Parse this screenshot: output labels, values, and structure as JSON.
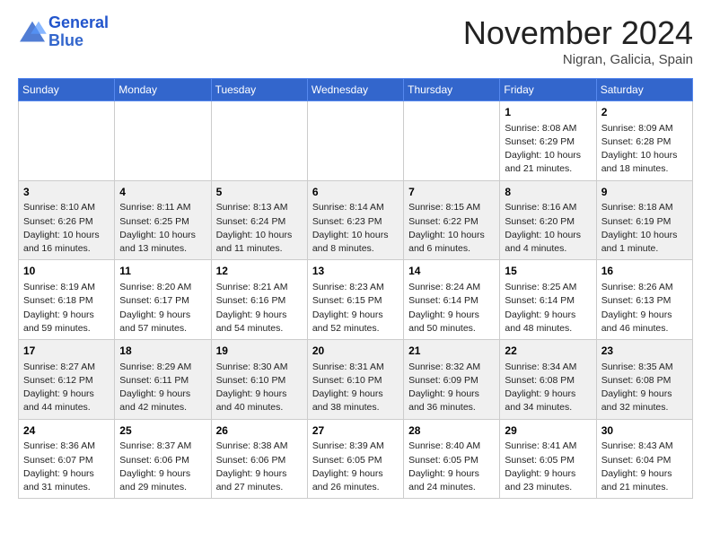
{
  "logo": {
    "line1": "General",
    "line2": "Blue"
  },
  "title": "November 2024",
  "location": "Nigran, Galicia, Spain",
  "days_header": [
    "Sunday",
    "Monday",
    "Tuesday",
    "Wednesday",
    "Thursday",
    "Friday",
    "Saturday"
  ],
  "weeks": [
    [
      {
        "num": "",
        "info": ""
      },
      {
        "num": "",
        "info": ""
      },
      {
        "num": "",
        "info": ""
      },
      {
        "num": "",
        "info": ""
      },
      {
        "num": "",
        "info": ""
      },
      {
        "num": "1",
        "info": "Sunrise: 8:08 AM\nSunset: 6:29 PM\nDaylight: 10 hours and 21 minutes."
      },
      {
        "num": "2",
        "info": "Sunrise: 8:09 AM\nSunset: 6:28 PM\nDaylight: 10 hours and 18 minutes."
      }
    ],
    [
      {
        "num": "3",
        "info": "Sunrise: 8:10 AM\nSunset: 6:26 PM\nDaylight: 10 hours and 16 minutes."
      },
      {
        "num": "4",
        "info": "Sunrise: 8:11 AM\nSunset: 6:25 PM\nDaylight: 10 hours and 13 minutes."
      },
      {
        "num": "5",
        "info": "Sunrise: 8:13 AM\nSunset: 6:24 PM\nDaylight: 10 hours and 11 minutes."
      },
      {
        "num": "6",
        "info": "Sunrise: 8:14 AM\nSunset: 6:23 PM\nDaylight: 10 hours and 8 minutes."
      },
      {
        "num": "7",
        "info": "Sunrise: 8:15 AM\nSunset: 6:22 PM\nDaylight: 10 hours and 6 minutes."
      },
      {
        "num": "8",
        "info": "Sunrise: 8:16 AM\nSunset: 6:20 PM\nDaylight: 10 hours and 4 minutes."
      },
      {
        "num": "9",
        "info": "Sunrise: 8:18 AM\nSunset: 6:19 PM\nDaylight: 10 hours and 1 minute."
      }
    ],
    [
      {
        "num": "10",
        "info": "Sunrise: 8:19 AM\nSunset: 6:18 PM\nDaylight: 9 hours and 59 minutes."
      },
      {
        "num": "11",
        "info": "Sunrise: 8:20 AM\nSunset: 6:17 PM\nDaylight: 9 hours and 57 minutes."
      },
      {
        "num": "12",
        "info": "Sunrise: 8:21 AM\nSunset: 6:16 PM\nDaylight: 9 hours and 54 minutes."
      },
      {
        "num": "13",
        "info": "Sunrise: 8:23 AM\nSunset: 6:15 PM\nDaylight: 9 hours and 52 minutes."
      },
      {
        "num": "14",
        "info": "Sunrise: 8:24 AM\nSunset: 6:14 PM\nDaylight: 9 hours and 50 minutes."
      },
      {
        "num": "15",
        "info": "Sunrise: 8:25 AM\nSunset: 6:14 PM\nDaylight: 9 hours and 48 minutes."
      },
      {
        "num": "16",
        "info": "Sunrise: 8:26 AM\nSunset: 6:13 PM\nDaylight: 9 hours and 46 minutes."
      }
    ],
    [
      {
        "num": "17",
        "info": "Sunrise: 8:27 AM\nSunset: 6:12 PM\nDaylight: 9 hours and 44 minutes."
      },
      {
        "num": "18",
        "info": "Sunrise: 8:29 AM\nSunset: 6:11 PM\nDaylight: 9 hours and 42 minutes."
      },
      {
        "num": "19",
        "info": "Sunrise: 8:30 AM\nSunset: 6:10 PM\nDaylight: 9 hours and 40 minutes."
      },
      {
        "num": "20",
        "info": "Sunrise: 8:31 AM\nSunset: 6:10 PM\nDaylight: 9 hours and 38 minutes."
      },
      {
        "num": "21",
        "info": "Sunrise: 8:32 AM\nSunset: 6:09 PM\nDaylight: 9 hours and 36 minutes."
      },
      {
        "num": "22",
        "info": "Sunrise: 8:34 AM\nSunset: 6:08 PM\nDaylight: 9 hours and 34 minutes."
      },
      {
        "num": "23",
        "info": "Sunrise: 8:35 AM\nSunset: 6:08 PM\nDaylight: 9 hours and 32 minutes."
      }
    ],
    [
      {
        "num": "24",
        "info": "Sunrise: 8:36 AM\nSunset: 6:07 PM\nDaylight: 9 hours and 31 minutes."
      },
      {
        "num": "25",
        "info": "Sunrise: 8:37 AM\nSunset: 6:06 PM\nDaylight: 9 hours and 29 minutes."
      },
      {
        "num": "26",
        "info": "Sunrise: 8:38 AM\nSunset: 6:06 PM\nDaylight: 9 hours and 27 minutes."
      },
      {
        "num": "27",
        "info": "Sunrise: 8:39 AM\nSunset: 6:05 PM\nDaylight: 9 hours and 26 minutes."
      },
      {
        "num": "28",
        "info": "Sunrise: 8:40 AM\nSunset: 6:05 PM\nDaylight: 9 hours and 24 minutes."
      },
      {
        "num": "29",
        "info": "Sunrise: 8:41 AM\nSunset: 6:05 PM\nDaylight: 9 hours and 23 minutes."
      },
      {
        "num": "30",
        "info": "Sunrise: 8:43 AM\nSunset: 6:04 PM\nDaylight: 9 hours and 21 minutes."
      }
    ]
  ]
}
